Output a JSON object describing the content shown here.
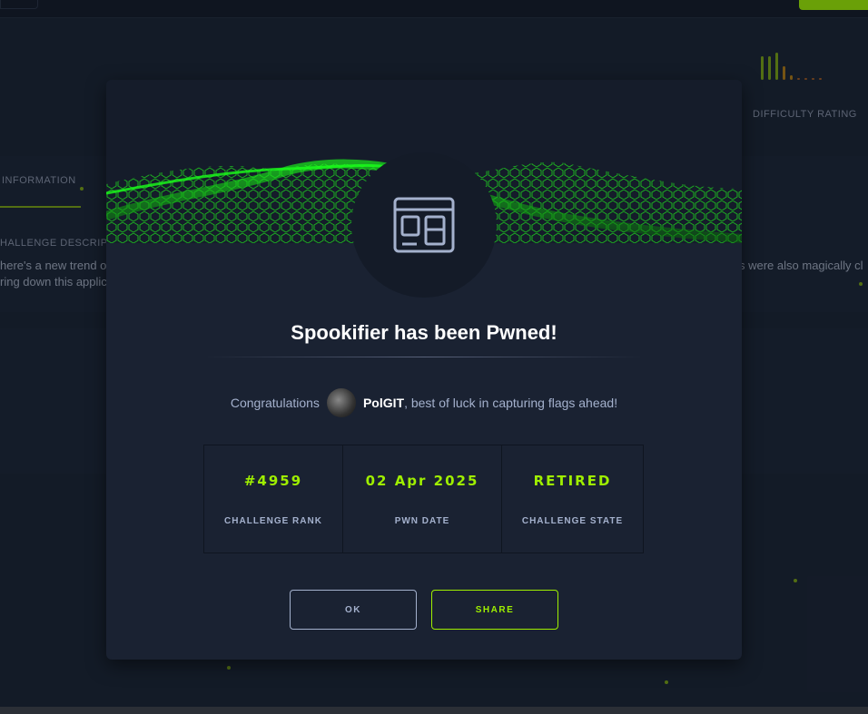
{
  "background": {
    "tab_information": "INFORMATION",
    "section_description": "HALLENGE DESCRIPT",
    "desc_line1_left": "here's a new trend o",
    "desc_line2_left": "ring down this applic",
    "desc_line1_right": "s were also magically cl",
    "difficulty_label": "DIFFICULTY RATING"
  },
  "modal": {
    "title": "Spookifier has been Pwned!",
    "congrats_prefix": "Congratulations",
    "username": "PolGIT",
    "congrats_suffix": ", best of luck in capturing flags ahead!",
    "stats": [
      {
        "value": "#4959",
        "label": "CHALLENGE RANK"
      },
      {
        "value": "02 Apr 2025",
        "label": "PWN DATE"
      },
      {
        "value": "RETIRED",
        "label": "CHALLENGE STATE"
      }
    ],
    "ok_label": "OK",
    "share_label": "SHARE"
  },
  "colors": {
    "accent": "#9fef00",
    "muted": "#a4b1cd"
  }
}
